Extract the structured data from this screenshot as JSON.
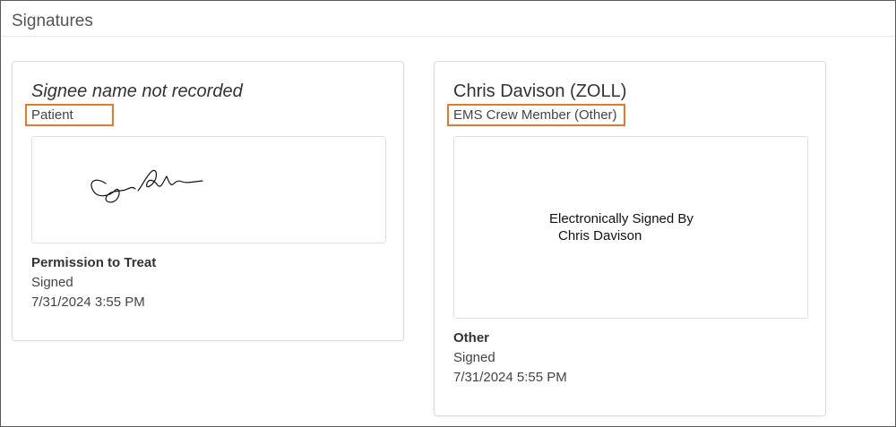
{
  "section": {
    "title": "Signatures"
  },
  "accent_color": "#e8792b",
  "cards": [
    {
      "signee": "Signee name not recorded",
      "role": "Patient",
      "signature_type": "handwritten",
      "document": "Permission to Treat",
      "status": "Signed",
      "datetime": "7/31/2024 3:55 PM"
    },
    {
      "signee": "Chris Davison (ZOLL)",
      "role": "EMS Crew Member (Other)",
      "signature_type": "electronic",
      "esig_line1": "Electronically Signed By",
      "esig_line2": "Chris Davison",
      "document": "Other",
      "status": "Signed",
      "datetime": "7/31/2024 5:55 PM"
    }
  ]
}
